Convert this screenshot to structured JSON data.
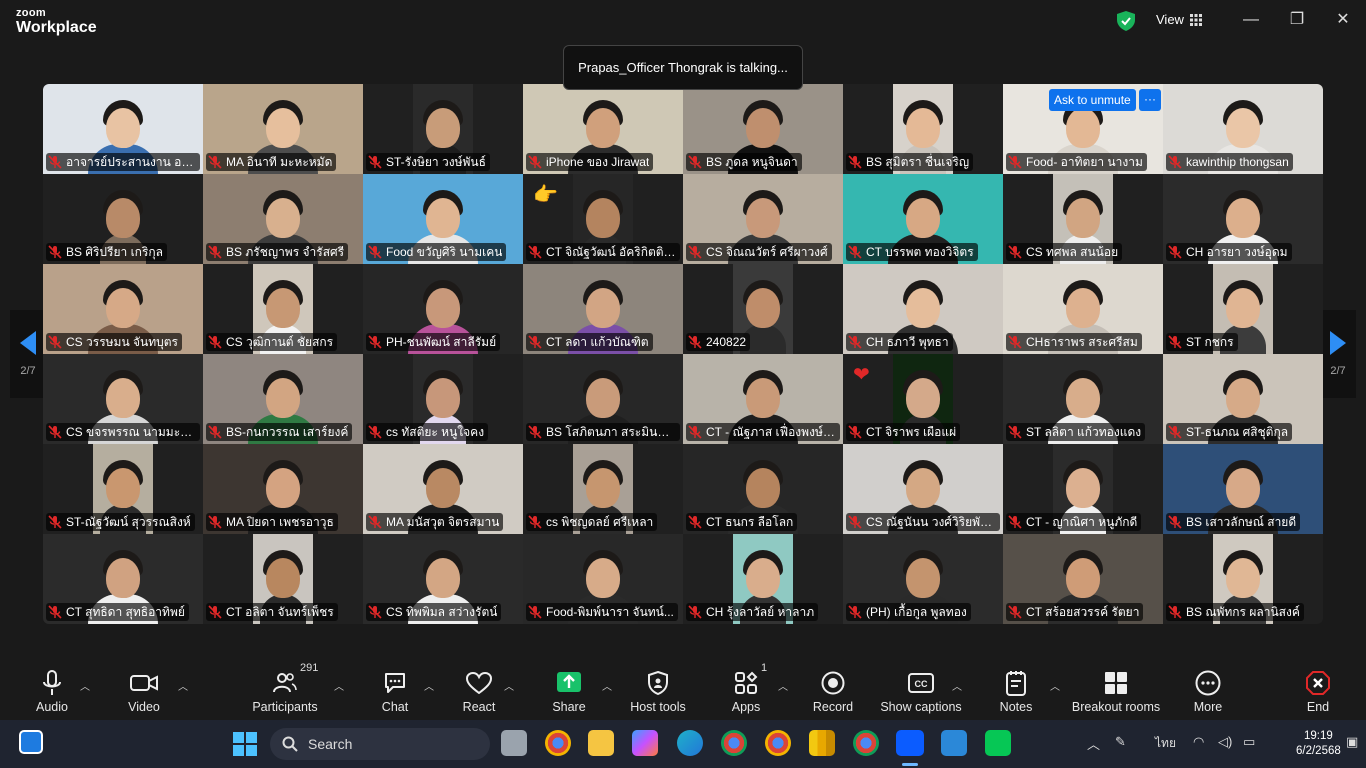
{
  "app": {
    "brand_small": "zoom",
    "brand_big": "Workplace",
    "view_label": "View"
  },
  "toast": "Prapas_Officer Thongrak is talking...",
  "overlay": {
    "ask_unmute": "Ask to unmute",
    "more": "···"
  },
  "pager": {
    "left_page": "2/7",
    "right_page": "2/7"
  },
  "reactions": {
    "thumbs": "👉",
    "heart": "❤"
  },
  "participants": [
    {
      "name": "อาจารย์ประสานงาน อ. จิร...",
      "bg": "#dfe4ea",
      "skin": "#e8c3a3",
      "shirt": "#3a6fb0"
    },
    {
      "name": "MA อินาที มะหะหมัด",
      "bg": "#b9a58b",
      "skin": "#e6bf9d",
      "shirt": "#4d4d4d"
    },
    {
      "name": "ST-รังษิยา วงษ์พันธ์",
      "bg": "#2a2a2a",
      "skin": "#c89c79",
      "shirt": "#1d1d1d"
    },
    {
      "name": "iPhone ของ Jirawat",
      "bg": "#cfc8b5",
      "skin": "#d0a07c",
      "shirt": "#2c2c2c"
    },
    {
      "name": "BS ภูดล หนูจินดา",
      "bg": "#9a9288",
      "skin": "#bf8f6e",
      "shirt": "#111111"
    },
    {
      "name": "BS สุมิตรา ชื่นเจริญ",
      "bg": "#d7d2cb",
      "skin": "#e4b996",
      "shirt": "#c9c3bb"
    },
    {
      "name": "Food- อาทิตยา นางาม",
      "bg": "#e8e5df",
      "skin": "#e3b895",
      "shirt": "#d9d4cc"
    },
    {
      "name": "kawinthip thongsan",
      "bg": "#dcdad6",
      "skin": "#eac6a7",
      "shirt": "#e8e6e3"
    },
    {
      "name": "BS ศิริปรียา เกริกุล",
      "bg": "#202020",
      "skin": "#b88a68",
      "shirt": "#7d6c5c"
    },
    {
      "name": "BS ภรัชญาพร จำรัสศรี",
      "bg": "#8d7e70",
      "skin": "#d8b08e",
      "shirt": "#3c3c3c"
    },
    {
      "name": "Food ขวัญศิริ นามเคน",
      "bg": "#58a8d8",
      "skin": "#e0b592",
      "shirt": "#e6e6e6"
    },
    {
      "name": "CT จิณัฐวัฒน์ อัคริกิตติปั...",
      "bg": "#262626",
      "skin": "#b4845f",
      "shirt": "#2a2a2a"
    },
    {
      "name": "CS จิณณวัตร์ ศรีผาวงศ์",
      "bg": "#b7ad9f",
      "skin": "#c8997a",
      "shirt": "#3a3a3a"
    },
    {
      "name": "CT บรรพต ทองวิจิตร",
      "bg": "#35b7b0",
      "skin": "#d7a884",
      "shirt": "#202020"
    },
    {
      "name": "CS ทศพล สนน้อย",
      "bg": "#c4c0b8",
      "skin": "#d1a582",
      "shirt": "#ededed"
    },
    {
      "name": "CH อารยา วงษ์อุดม",
      "bg": "#2b2b2b",
      "skin": "#dcaf8c",
      "shirt": "#f0f0f0"
    },
    {
      "name": "CS วรรษมน จันทบุตร",
      "bg": "#b9a18a",
      "skin": "#d6a987",
      "shirt": "#7a5c48"
    },
    {
      "name": "CS วุฒิกานต์ ชัยสกร",
      "bg": "#cfc7bb",
      "skin": "#c79874",
      "shirt": "#f2f2f2"
    },
    {
      "name": "PH-ชนพัฒน์ สาลีรัมย์",
      "bg": "#262626",
      "skin": "#c8987a",
      "shirt": "#b8529a"
    },
    {
      "name": "CT ลดา แก้วบัณฑิต",
      "bg": "#8d857c",
      "skin": "#d2a584",
      "shirt": "#7b4fa8"
    },
    {
      "name": "240822",
      "bg": "#3a3a3a",
      "skin": "#bf8d6a",
      "shirt": "#2b2b2b"
    },
    {
      "name": "CH ธภาวี พุทธา",
      "bg": "#cfc9c2",
      "skin": "#e5bd9b",
      "shirt": "#2f2f2f"
    },
    {
      "name": "CHธาราพร สระศรีสม",
      "bg": "#ddd8cf",
      "skin": "#ddb18f",
      "shirt": "#c4beb6"
    },
    {
      "name": "ST กชกร",
      "bg": "#c4bdb3",
      "skin": "#e0b593",
      "shirt": "#3c3c3c"
    },
    {
      "name": "CS ขจรพรรณ นามมะปราง",
      "bg": "#2a2a2a",
      "skin": "#d9ae8c",
      "shirt": "#d6d6d6"
    },
    {
      "name": "BS-กนกวรรณ เสาร์ยงค์",
      "bg": "#8f8680",
      "skin": "#d2a582",
      "shirt": "#2f7a43"
    },
    {
      "name": "cs ทัสติยะ หนูใจคง",
      "bg": "#2a2a2a",
      "skin": "#c7977a",
      "shirt": "#e2d8ef"
    },
    {
      "name": "BS โสภิตนภา สระมินสิงห์",
      "bg": "#272727",
      "skin": "#c99b7a",
      "shirt": "#1f1f1f"
    },
    {
      "name": "CT - ณัฐภาส เฟื่องพงษ์พ...",
      "bg": "#b8b3a9",
      "skin": "#c99a78",
      "shirt": "#1e1e1e"
    },
    {
      "name": "CT จิราพร เผือแผ่",
      "bg": "#0f2610",
      "skin": "#d4a98a",
      "shirt": "#2a2a2a"
    },
    {
      "name": "ST ลลิตา แก้วทองแดง",
      "bg": "#2a2a2a",
      "skin": "#d8ad8b",
      "shirt": "#eeeeee"
    },
    {
      "name": "ST-ธนภณ ศสิชุติกุล",
      "bg": "#cbc4ba",
      "skin": "#d6aa88",
      "shirt": "#2d2d2d"
    },
    {
      "name": "ST-ณัฐวัฒน์ สุวรรณสิงห์",
      "bg": "#b5ae9f",
      "skin": "#c9976f",
      "shirt": "#2b2b2b"
    },
    {
      "name": "MA ปิยดา เพชรอาวุธ",
      "bg": "#3d3631",
      "skin": "#d4a381",
      "shirt": "#1e1e1e"
    },
    {
      "name": "MA มนัสวุต จิตรสมาน",
      "bg": "#d0cbc3",
      "skin": "#b98963",
      "shirt": "#202020"
    },
    {
      "name": "cs พิชญดลย์ ศรีเหลา",
      "bg": "#a9a096",
      "skin": "#c6966f",
      "shirt": "#2a2a2a"
    },
    {
      "name": "CT ธนกร ลือโลก",
      "bg": "#262626",
      "skin": "#b5845e",
      "shirt": "#2a2a2a"
    },
    {
      "name": "CS ณัฐนันน วงศ์วิริยพัฒ...",
      "bg": "#d1cfcc",
      "skin": "#d4a884",
      "shirt": "#303030"
    },
    {
      "name": "CT - ญาณิศา หนูภักดี",
      "bg": "#2b2b2b",
      "skin": "#dcb090",
      "shirt": "#efefef"
    },
    {
      "name": "BS เสาวลักษณ์ สายดี",
      "bg": "#2e4f78",
      "skin": "#d7a988",
      "shirt": "#2a2a2a"
    },
    {
      "name": "CT สุทธิดา สุทธิอาทิพย์",
      "bg": "#2b2b2b",
      "skin": "#d0a281",
      "shirt": "#eeeeee"
    },
    {
      "name": "CT อลิตา จันทร์เพ็ชร",
      "bg": "#c9c5bf",
      "skin": "#b8875f",
      "shirt": "#2a2a2a"
    },
    {
      "name": "CS ทิพพิมล สว่างรัตน์",
      "bg": "#2a2a2a",
      "skin": "#d3a684",
      "shirt": "#eeeeee"
    },
    {
      "name": "Food-พิมพ์นารา จันทน์...",
      "bg": "#282828",
      "skin": "#d7ab89",
      "shirt": "#2a2a2a"
    },
    {
      "name": "CH รุ้งลาวัลย์ หาลาภ",
      "bg": "#8fc9c2",
      "skin": "#d9ad8c",
      "shirt": "#333333"
    },
    {
      "name": "(PH) เกื้อกูล พูลทอง",
      "bg": "#2b2b2b",
      "skin": "#c4946e",
      "shirt": "#2a2a2a"
    },
    {
      "name": "CT สร้อยสวรรค์ รัตยา",
      "bg": "#565049",
      "skin": "#cf9c77",
      "shirt": "#2c2c2c"
    },
    {
      "name": "BS ณพัทกร ผลานิสงค์",
      "bg": "#cfc9c0",
      "skin": "#e0b795",
      "shirt": "#3a3a3a"
    }
  ],
  "toolbar": {
    "audio": "Audio",
    "video": "Video",
    "participants": "Participants",
    "participants_count": "291",
    "chat": "Chat",
    "react": "React",
    "share": "Share",
    "host_tools": "Host tools",
    "apps": "Apps",
    "apps_count": "1",
    "record": "Record",
    "captions": "Show captions",
    "notes": "Notes",
    "breakout": "Breakout rooms",
    "more": "More",
    "end": "End"
  },
  "taskbar": {
    "search_label": "Search",
    "lang": "ไทย",
    "time": "19:19",
    "date": "6/2/2568"
  },
  "colors": {
    "accent": "#0e72ed",
    "share_green": "#19c26a",
    "end_red": "#e02828",
    "mic_muted": "#e02828",
    "arrow_blue": "#2e8ef5"
  }
}
